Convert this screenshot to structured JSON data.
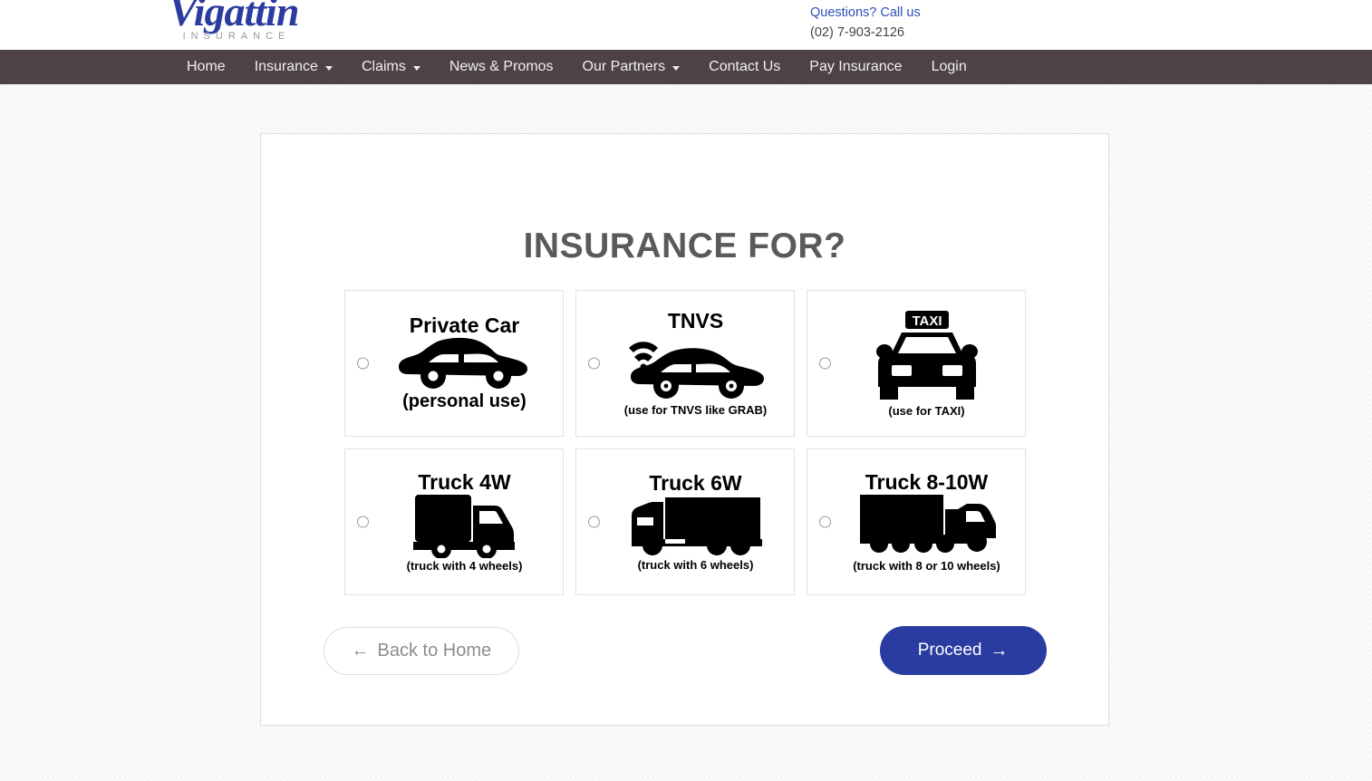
{
  "header": {
    "logo_word": "Vigattin",
    "logo_sub": "INSURANCE",
    "contact_question": "Questions? Call us",
    "contact_phone": "(02) 7-903-2126"
  },
  "nav": {
    "items": [
      {
        "label": "Home",
        "caret": false
      },
      {
        "label": "Insurance",
        "caret": true
      },
      {
        "label": "Claims",
        "caret": true
      },
      {
        "label": "News & Promos",
        "caret": false
      },
      {
        "label": "Our Partners",
        "caret": true
      },
      {
        "label": "Contact Us",
        "caret": false
      },
      {
        "label": "Pay Insurance",
        "caret": false
      },
      {
        "label": "Login",
        "caret": false
      }
    ]
  },
  "main": {
    "title": "INSURANCE FOR?",
    "options": [
      {
        "id": "private-car",
        "title": "Private Car",
        "subtitle": "(personal use)",
        "icon": "sedan-car-icon",
        "selected": false,
        "subtitle_size": "big"
      },
      {
        "id": "tnvs",
        "title": "TNVS",
        "subtitle": "(use for TNVS like GRAB)",
        "icon": "tnvs-car-wifi-icon",
        "selected": false,
        "subtitle_size": "small"
      },
      {
        "id": "taxi",
        "title": "",
        "subtitle": "(use for TAXI)",
        "icon": "taxi-front-icon",
        "selected": false,
        "subtitle_size": "small"
      },
      {
        "id": "truck-4w",
        "title": "Truck 4W",
        "subtitle": "(truck with 4 wheels)",
        "icon": "box-truck-4w-icon",
        "selected": false,
        "subtitle_size": "small"
      },
      {
        "id": "truck-6w",
        "title": "Truck 6W",
        "subtitle": "(truck with 6 wheels)",
        "icon": "box-truck-6w-icon",
        "selected": false,
        "subtitle_size": "small"
      },
      {
        "id": "truck-8-10w",
        "title": "Truck 8-10W",
        "subtitle": "(truck with 8 or 10 wheels)",
        "icon": "semi-truck-8-10w-icon",
        "selected": false,
        "subtitle_size": "small"
      }
    ],
    "back_button": "Back to Home",
    "back_arrow": "←",
    "proceed_button": "Proceed",
    "proceed_arrow": "→"
  },
  "colors": {
    "nav_bg": "#4d4344",
    "logo_blue": "#2b3b9e",
    "link_blue": "#2b4fbb",
    "proceed_blue": "#2b3ca0",
    "title_gray": "#5a5a5a",
    "page_bg": "#fbfbfb"
  }
}
